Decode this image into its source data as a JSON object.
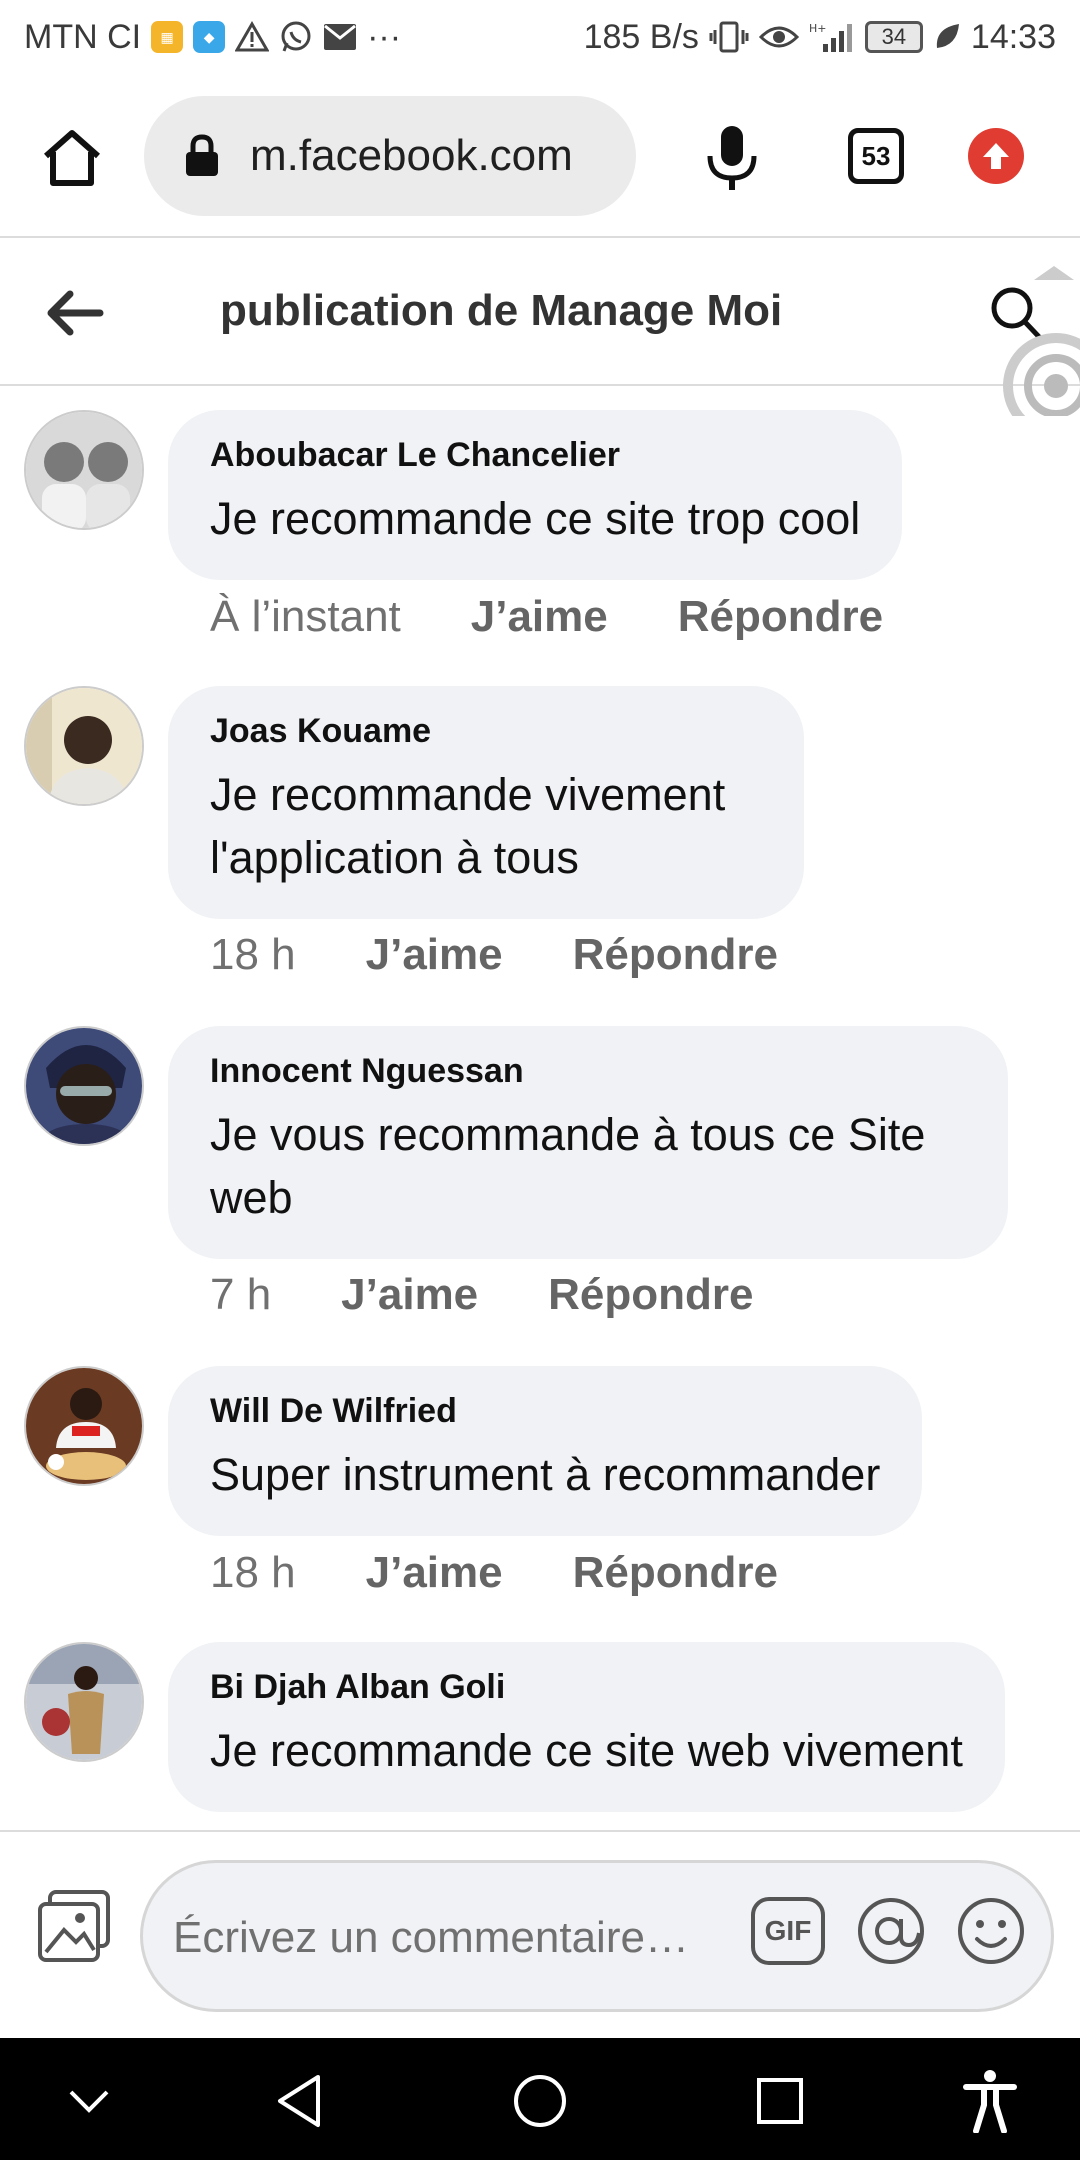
{
  "status_bar": {
    "carrier": "MTN CI",
    "speed": "185 B/s",
    "battery": "34",
    "time": "14:33",
    "more": "···"
  },
  "browser": {
    "url": "m.facebook.com",
    "tab_count": "53"
  },
  "header": {
    "title": "publication de Manage Moi"
  },
  "comments": [
    {
      "author": "Aboubacar Le Chancelier",
      "text": "Je recommande ce site trop cool",
      "time": "À l’instant",
      "like": "J’aime",
      "reply": "Répondre"
    },
    {
      "author": "Joas Kouame",
      "text": "Je recommande vivement l'application à tous",
      "time": "18 h",
      "like": "J’aime",
      "reply": "Répondre"
    },
    {
      "author": "Innocent Nguessan",
      "text": "Je vous recommande à tous ce Site web",
      "time": "7 h",
      "like": "J’aime",
      "reply": "Répondre"
    },
    {
      "author": "Will De Wilfried",
      "text": "Super instrument à recommander",
      "time": "18 h",
      "like": "J’aime",
      "reply": "Répondre"
    },
    {
      "author": "Bi Djah Alban Goli",
      "text": "Je recommande ce site web vivement",
      "time": "",
      "like": "",
      "reply": ""
    }
  ],
  "composer": {
    "placeholder": "Écrivez un commentaire…",
    "gif_label": "GIF"
  },
  "colors": {
    "bubble": "#f0f2f5",
    "accent_red": "#e03c31",
    "meta_gray": "#707070"
  },
  "icons": [
    "home-icon",
    "lock-icon",
    "microphone-icon",
    "tabs-icon",
    "update-icon",
    "back-arrow-icon",
    "search-icon",
    "photo-icon",
    "gif-icon",
    "mention-icon",
    "emoji-icon",
    "chevron-down-icon",
    "back-triangle-icon",
    "home-circle-icon",
    "recents-square-icon",
    "accessibility-icon"
  ]
}
